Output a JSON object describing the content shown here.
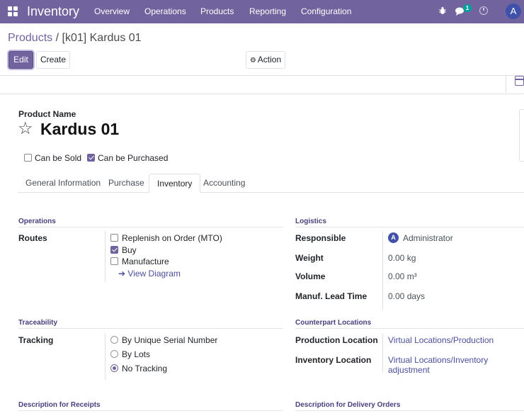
{
  "navbar": {
    "app_title": "Inventory",
    "menu": [
      "Overview",
      "Operations",
      "Products",
      "Reporting",
      "Configuration"
    ],
    "messages_count": "1",
    "avatar_letter": "A",
    "icons": [
      "apps-grid-icon",
      "bug-icon",
      "chat-icon",
      "clock-icon"
    ]
  },
  "breadcrumb": {
    "parent": "Products",
    "separator": "/",
    "current": "[k01] Kardus 01"
  },
  "toolbar": {
    "edit_label": "Edit",
    "create_label": "Create",
    "action_label": "Action"
  },
  "product": {
    "name_label": "Product Name",
    "name": "Kardus 01",
    "can_be_sold_label": "Can be Sold",
    "can_be_sold": false,
    "can_be_purchased_label": "Can be Purchased",
    "can_be_purchased": true
  },
  "tabs": [
    {
      "label": "General Information",
      "active": false
    },
    {
      "label": "Purchase",
      "active": false
    },
    {
      "label": "Inventory",
      "active": true
    },
    {
      "label": "Accounting",
      "active": false
    }
  ],
  "operations": {
    "title": "Operations",
    "routes_label": "Routes",
    "routes": [
      {
        "label": "Replenish on Order (MTO)",
        "checked": false
      },
      {
        "label": "Buy",
        "checked": true
      },
      {
        "label": "Manufacture",
        "checked": false
      }
    ],
    "view_diagram_label": "View Diagram"
  },
  "logistics": {
    "title": "Logistics",
    "responsible_label": "Responsible",
    "responsible_avatar": "A",
    "responsible": "Administrator",
    "weight_label": "Weight",
    "weight": "0.00 kg",
    "volume_label": "Volume",
    "volume": "0.00 m³",
    "lead_time_label": "Manuf. Lead Time",
    "lead_time": "0.00 days"
  },
  "traceability": {
    "title": "Traceability",
    "tracking_label": "Tracking",
    "options": [
      {
        "label": "By Unique Serial Number",
        "selected": false
      },
      {
        "label": "By Lots",
        "selected": false
      },
      {
        "label": "No Tracking",
        "selected": true
      }
    ]
  },
  "counterpart": {
    "title": "Counterpart Locations",
    "production_label": "Production Location",
    "production": "Virtual Locations/Production",
    "inventory_label": "Inventory Location",
    "inventory": "Virtual Locations/Inventory adjustment"
  },
  "descriptions": {
    "receipts_title": "Description for Receipts",
    "delivery_title": "Description for Delivery Orders"
  },
  "colors": {
    "brand": "#71639e",
    "badge": "#00a09d",
    "link": "#4b4f9a"
  }
}
